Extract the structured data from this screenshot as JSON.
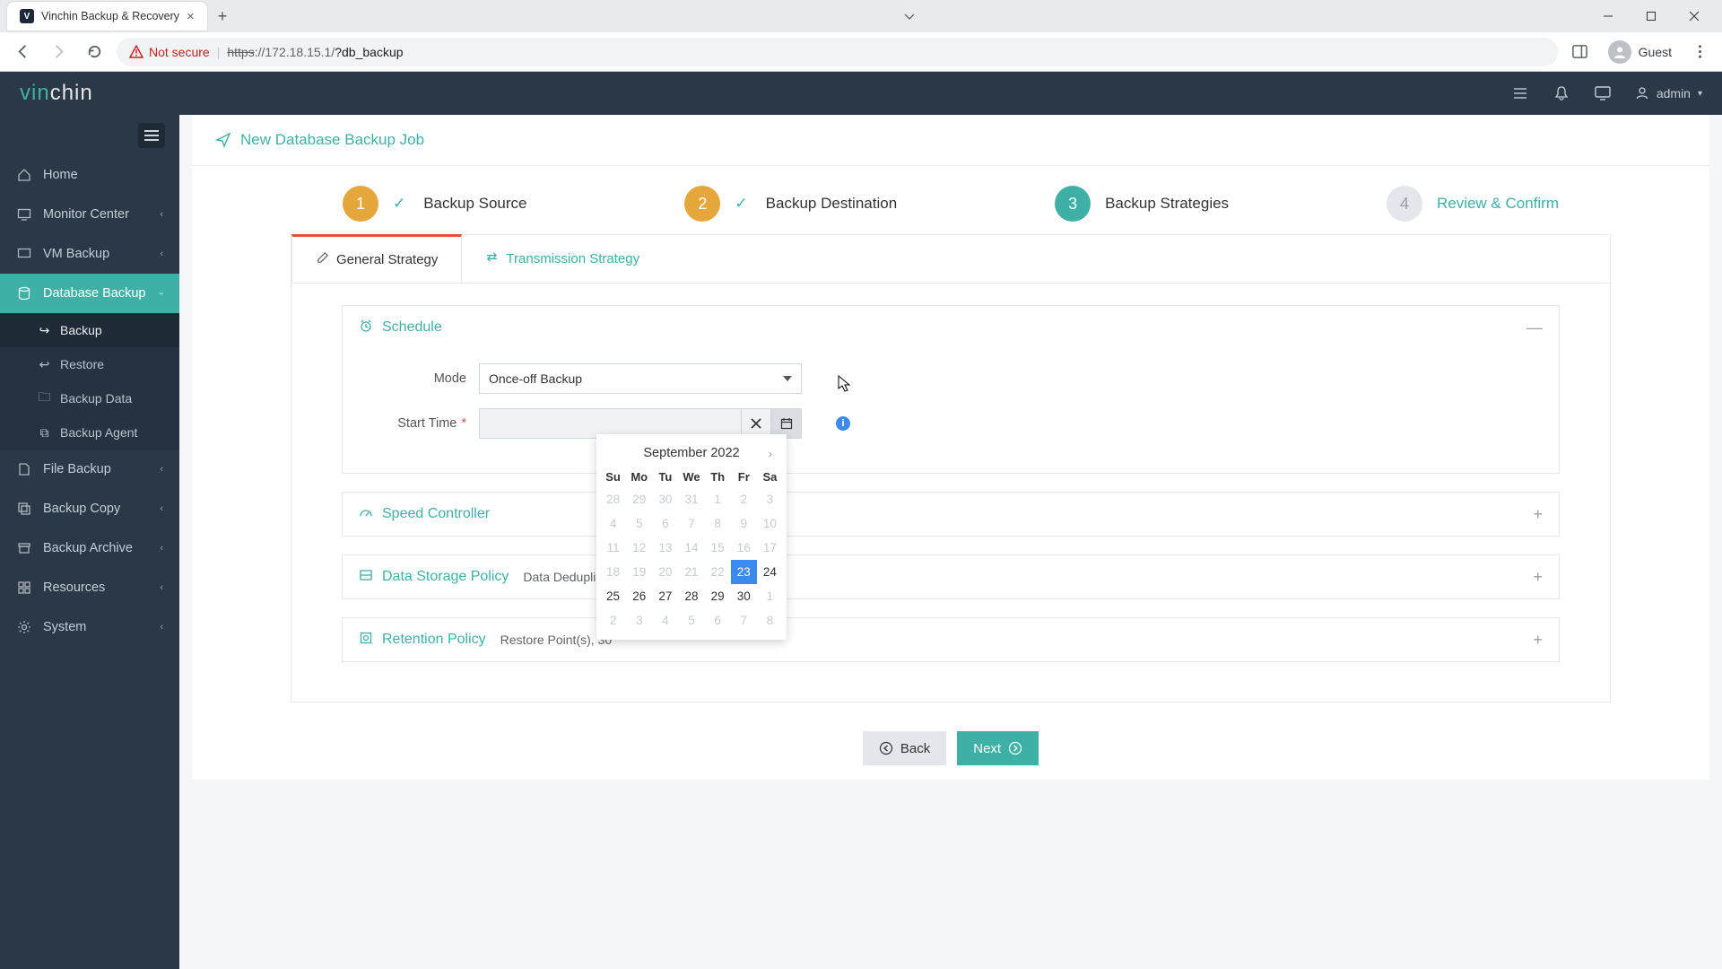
{
  "browser": {
    "tab_title": "Vinchin Backup & Recovery",
    "not_secure": "Not secure",
    "url_proto": "https",
    "url_host": "://172.18.15.1/",
    "url_path": "?db_backup",
    "guest": "Guest"
  },
  "header": {
    "user": "admin"
  },
  "sidebar": {
    "items": [
      {
        "label": "Home"
      },
      {
        "label": "Monitor Center"
      },
      {
        "label": "VM Backup"
      },
      {
        "label": "Database Backup"
      },
      {
        "label": "File Backup"
      },
      {
        "label": "Backup Copy"
      },
      {
        "label": "Backup Archive"
      },
      {
        "label": "Resources"
      },
      {
        "label": "System"
      }
    ],
    "db_sub": [
      {
        "label": "Backup"
      },
      {
        "label": "Restore"
      },
      {
        "label": "Backup Data"
      },
      {
        "label": "Backup Agent"
      }
    ]
  },
  "page": {
    "title": "New Database Backup Job",
    "steps": [
      {
        "n": "1",
        "label": "Backup Source"
      },
      {
        "n": "2",
        "label": "Backup Destination"
      },
      {
        "n": "3",
        "label": "Backup Strategies"
      },
      {
        "n": "4",
        "label": "Review & Confirm"
      }
    ],
    "subtabs": {
      "general": "General Strategy",
      "transmission": "Transmission Strategy"
    },
    "panel": {
      "schedule": "Schedule",
      "mode_label": "Mode",
      "mode_value": "Once-off Backup",
      "start_label": "Start Time",
      "speed": "Speed Controller",
      "storage": "Data Storage Policy",
      "storage_sub": "Data Deduplication: OFF",
      "retention": "Retention Policy",
      "retention_sub": "Restore Point(s), 30"
    },
    "buttons": {
      "back": "Back",
      "next": "Next"
    },
    "calendar": {
      "month": "September 2022",
      "dow": [
        "Su",
        "Mo",
        "Tu",
        "We",
        "Th",
        "Fr",
        "Sa"
      ],
      "days": [
        {
          "d": "28",
          "mute": true
        },
        {
          "d": "29",
          "mute": true
        },
        {
          "d": "30",
          "mute": true
        },
        {
          "d": "31",
          "mute": true
        },
        {
          "d": "1",
          "mute": true
        },
        {
          "d": "2",
          "mute": true
        },
        {
          "d": "3",
          "mute": true
        },
        {
          "d": "4",
          "mute": true
        },
        {
          "d": "5",
          "mute": true
        },
        {
          "d": "6",
          "mute": true
        },
        {
          "d": "7",
          "mute": true
        },
        {
          "d": "8",
          "mute": true
        },
        {
          "d": "9",
          "mute": true
        },
        {
          "d": "10",
          "mute": true
        },
        {
          "d": "11",
          "mute": true
        },
        {
          "d": "12",
          "mute": true
        },
        {
          "d": "13",
          "mute": true
        },
        {
          "d": "14",
          "mute": true
        },
        {
          "d": "15",
          "mute": true
        },
        {
          "d": "16",
          "mute": true
        },
        {
          "d": "17",
          "mute": true
        },
        {
          "d": "18",
          "mute": true
        },
        {
          "d": "19",
          "mute": true
        },
        {
          "d": "20",
          "mute": true
        },
        {
          "d": "21",
          "mute": true
        },
        {
          "d": "22",
          "mute": true
        },
        {
          "d": "23",
          "today": true
        },
        {
          "d": "24"
        },
        {
          "d": "25"
        },
        {
          "d": "26"
        },
        {
          "d": "27"
        },
        {
          "d": "28"
        },
        {
          "d": "29"
        },
        {
          "d": "30"
        },
        {
          "d": "1",
          "mute": true
        },
        {
          "d": "2",
          "mute": true
        },
        {
          "d": "3",
          "mute": true
        },
        {
          "d": "4",
          "mute": true
        },
        {
          "d": "5",
          "mute": true
        },
        {
          "d": "6",
          "mute": true
        },
        {
          "d": "7",
          "mute": true
        },
        {
          "d": "8",
          "mute": true
        }
      ]
    }
  }
}
